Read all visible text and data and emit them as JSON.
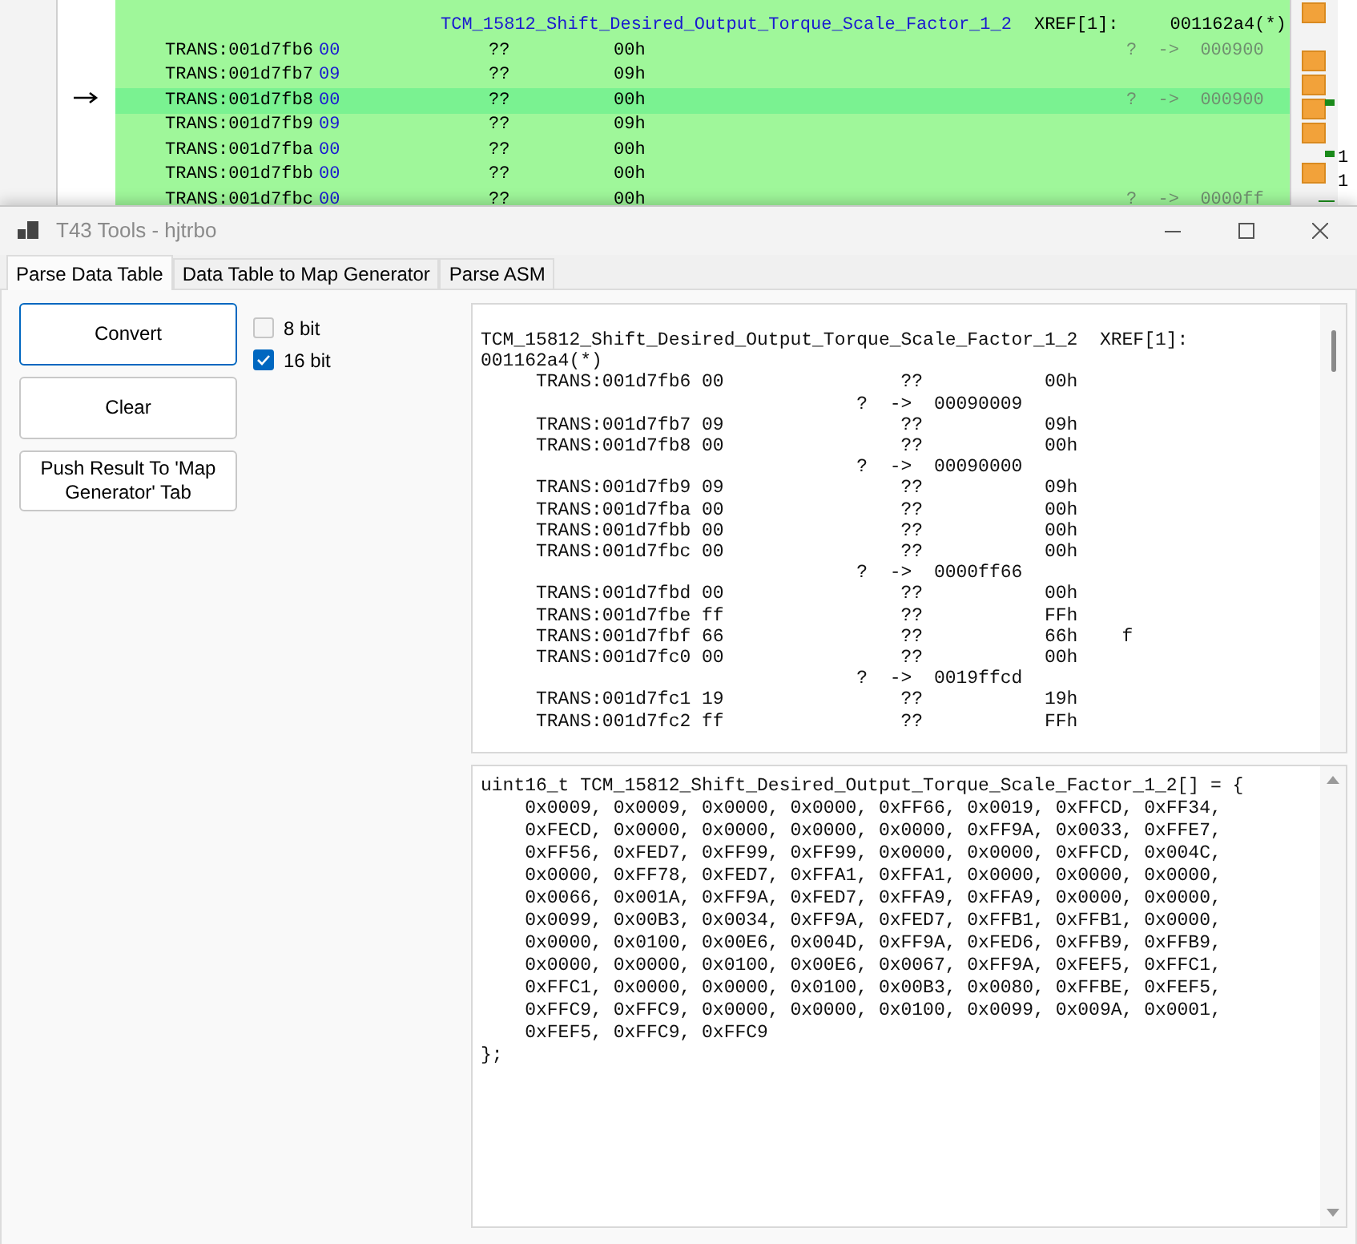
{
  "background_listing": {
    "header": {
      "label": "TCM_15812_Shift_Desired_Output_Torque_Scale_Factor_1_2",
      "xref": "XREF[1]:",
      "ref": "001162a4(*)"
    },
    "rows": [
      {
        "address": "TRANS:001d7fb6",
        "byte": "00",
        "type": "??",
        "value": "00h",
        "ref": "?  ->  000900",
        "selected": false
      },
      {
        "address": "TRANS:001d7fb7",
        "byte": "09",
        "type": "??",
        "value": "09h",
        "selected": false
      },
      {
        "address": "TRANS:001d7fb8",
        "byte": "00",
        "type": "??",
        "value": "00h",
        "ref": "?  ->  000900",
        "selected": true
      },
      {
        "address": "TRANS:001d7fb9",
        "byte": "09",
        "type": "??",
        "value": "09h",
        "selected": false
      },
      {
        "address": "TRANS:001d7fba",
        "byte": "00",
        "type": "??",
        "value": "00h",
        "selected": false
      },
      {
        "address": "TRANS:001d7fbb",
        "byte": "00",
        "type": "??",
        "value": "00h",
        "selected": false
      },
      {
        "address": "TRANS:001d7fbc",
        "byte": "00",
        "type": "??",
        "value": "00h",
        "ref": "?  ->  0000ff",
        "selected": false
      }
    ]
  },
  "edge_fragments": [
    "1",
    "1"
  ],
  "window": {
    "title": "T43 Tools - hjtrbo"
  },
  "tabs": [
    {
      "label": "Parse Data Table",
      "selected": true
    },
    {
      "label": "Data Table to Map Generator",
      "selected": false
    },
    {
      "label": "Parse ASM",
      "selected": false
    }
  ],
  "buttons": [
    {
      "label": "Convert",
      "focused": true
    },
    {
      "label": "Clear",
      "focused": false
    },
    {
      "label": "Push Result To 'Map Generator' Tab",
      "focused": false
    }
  ],
  "options": [
    {
      "label": "8 bit",
      "checked": false
    },
    {
      "label": "16 bit",
      "checked": true
    }
  ],
  "input_text": {
    "lines": [
      "TCM_15812_Shift_Desired_Output_Torque_Scale_Factor_1_2  XREF[1]:",
      "001162a4(*)",
      "     TRANS:001d7fb6 00                ??           00h",
      "                                  ?  ->  00090009",
      "     TRANS:001d7fb7 09                ??           09h",
      "     TRANS:001d7fb8 00                ??           00h",
      "                                  ?  ->  00090000",
      "     TRANS:001d7fb9 09                ??           09h",
      "     TRANS:001d7fba 00                ??           00h",
      "     TRANS:001d7fbb 00                ??           00h",
      "     TRANS:001d7fbc 00                ??           00h",
      "                                  ?  ->  0000ff66",
      "     TRANS:001d7fbd 00                ??           00h",
      "     TRANS:001d7fbe ff                ??           FFh",
      "     TRANS:001d7fbf 66                ??           66h    f",
      "     TRANS:001d7fc0 00                ??           00h",
      "                                  ?  ->  0019ffcd",
      "     TRANS:001d7fc1 19                ??           19h",
      "     TRANS:001d7fc2 ff                ??           FFh"
    ]
  },
  "output_text": {
    "lines": [
      "uint16_t TCM_15812_Shift_Desired_Output_Torque_Scale_Factor_1_2[] = {",
      "    0x0009, 0x0009, 0x0000, 0x0000, 0xFF66, 0x0019, 0xFFCD, 0xFF34,",
      "    0xFECD, 0x0000, 0x0000, 0x0000, 0x0000, 0xFF9A, 0x0033, 0xFFE7,",
      "    0xFF56, 0xFED7, 0xFF99, 0xFF99, 0x0000, 0x0000, 0xFFCD, 0x004C,",
      "    0x0000, 0xFF78, 0xFED7, 0xFFA1, 0xFFA1, 0x0000, 0x0000, 0x0000,",
      "    0x0066, 0x001A, 0xFF9A, 0xFED7, 0xFFA9, 0xFFA9, 0x0000, 0x0000,",
      "    0x0099, 0x00B3, 0x0034, 0xFF9A, 0xFED7, 0xFFB1, 0xFFB1, 0x0000,",
      "    0x0000, 0x0100, 0x00E6, 0x004D, 0xFF9A, 0xFED6, 0xFFB9, 0xFFB9,",
      "    0x0000, 0x0000, 0x0100, 0x00E6, 0x0067, 0xFF9A, 0xFEF5, 0xFFC1,",
      "    0xFFC1, 0x0000, 0x0000, 0x0100, 0x00B3, 0x0080, 0xFFBE, 0xFEF5,",
      "    0xFFC9, 0xFFC9, 0x0000, 0x0000, 0x0100, 0x0099, 0x009A, 0x0001,",
      "    0xFEF5, 0xFFC9, 0xFFC9",
      "};"
    ]
  }
}
